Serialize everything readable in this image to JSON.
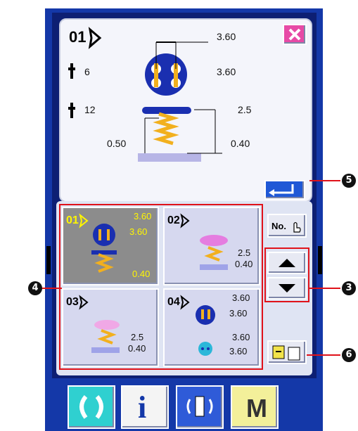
{
  "pattern": {
    "number": "01",
    "dims": {
      "width": "3.60",
      "height": "3.60",
      "thread_left": "6",
      "thread_left2": "12",
      "length": "2.5",
      "shank": "0.40",
      "base": "0.50"
    }
  },
  "tiles": [
    {
      "number": "01",
      "v1": "3.60",
      "v2": "3.60",
      "v3": "0.40"
    },
    {
      "number": "02",
      "v1": "2.5",
      "v2": "0.40"
    },
    {
      "number": "03",
      "v1": "2.5",
      "v2": "0.40"
    },
    {
      "number": "04",
      "v1": "3.60",
      "v2": "3.60",
      "v3": "3.60",
      "v4": "3.60"
    }
  ],
  "buttons": {
    "no_label": "No."
  },
  "callouts": [
    "3",
    "4",
    "5",
    "6"
  ],
  "bottom_bar": {
    "info_label": "i",
    "menu_label": "M"
  },
  "colors": {
    "accent": "#1438a8",
    "selected_tile": "#8c8c8c",
    "tile_bg": "#d6d8ef",
    "close": "#e74aa6"
  }
}
